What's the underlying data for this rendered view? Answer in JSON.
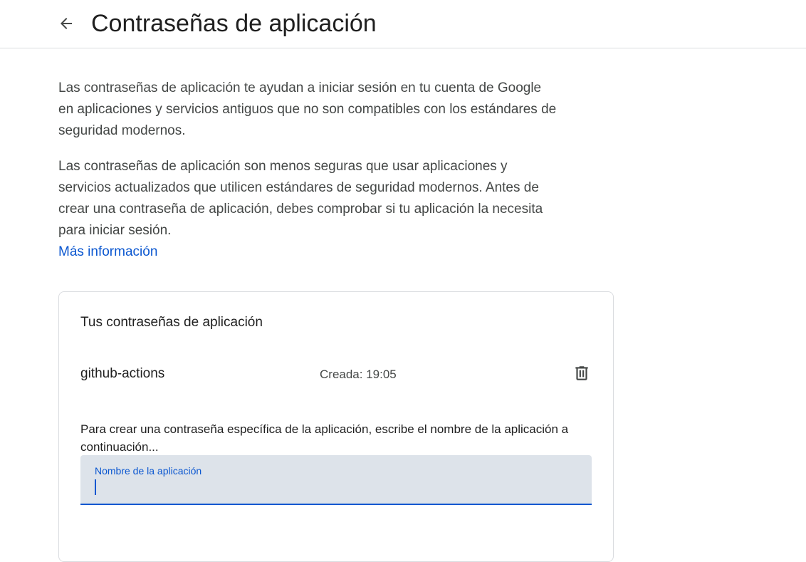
{
  "header": {
    "back_icon": "arrow-back-icon",
    "title": "Contraseñas de aplicación"
  },
  "intro": {
    "paragraph1": "Las contraseñas de aplicación te ayudan a iniciar sesión en tu cuenta de Google en aplicaciones y servicios antiguos que no son compatibles con los estándares de seguridad modernos.",
    "paragraph2": "Las contraseñas de aplicación son menos seguras que usar aplicaciones y servicios actualizados que utilicen estándares de seguridad modernos. Antes de crear una contraseña de aplicación, debes comprobar si tu aplicación la necesita para iniciar sesión.",
    "more_link": "Más información"
  },
  "card": {
    "title": "Tus contraseñas de aplicación",
    "passwords": [
      {
        "name": "github-actions",
        "created": "Creada: 19:05",
        "delete_icon": "trash-icon"
      }
    ],
    "create_hint": "Para crear una contraseña específica de la aplicación, escribe el nombre de la aplicación a continuación...",
    "app_name_field": {
      "label": "Nombre de la aplicación",
      "value": ""
    }
  },
  "colors": {
    "link": "#0b57d0",
    "field_background": "#dde3ea",
    "field_underline": "#0b57d0",
    "secondary_text": "#444746",
    "divider": "#dadce0"
  }
}
